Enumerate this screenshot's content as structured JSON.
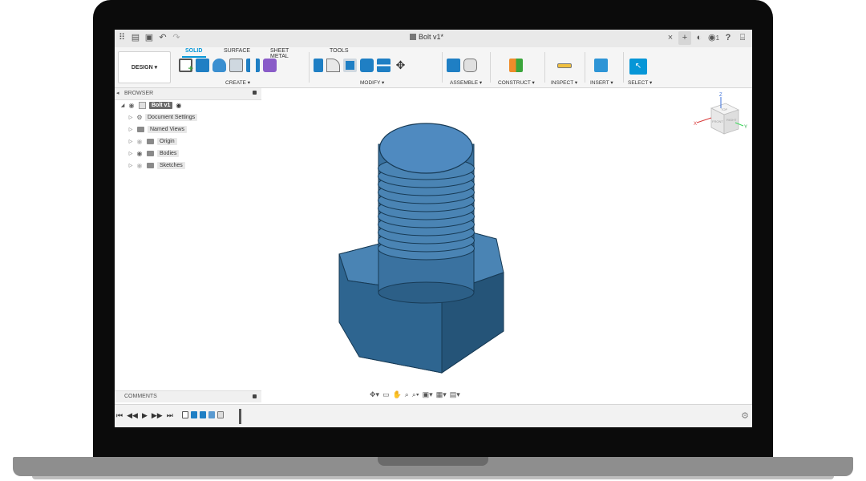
{
  "titlebar": {
    "doc_title": "Bolt v1*",
    "close_icon": "×",
    "plus_icon": "+",
    "notification_count": "1",
    "help_icon": "?",
    "icons": [
      "grid-icon",
      "file-icon",
      "save-icon",
      "undo-icon",
      "redo-icon"
    ]
  },
  "ribbon": {
    "tabs": [
      "SOLID",
      "SURFACE",
      "SHEET METAL",
      "TOOLS"
    ],
    "active_tab": "SOLID",
    "workspace": "DESIGN ▾",
    "groups": [
      "CREATE ▾",
      "MODIFY ▾",
      "ASSEMBLE ▾",
      "CONSTRUCT ▾",
      "INSPECT ▾",
      "INSERT ▾",
      "SELECT ▾"
    ]
  },
  "browser": {
    "title": "BROWSER",
    "root": "Bolt v1",
    "items": [
      "Document Settings",
      "Named Views",
      "Origin",
      "Bodies",
      "Sketches"
    ]
  },
  "comments": {
    "title": "COMMENTS"
  },
  "viewcube": {
    "top": "TOP",
    "front": "FRONT",
    "right": "RIGHT",
    "x": "X",
    "y": "Y",
    "z": "Z"
  },
  "colors": {
    "accent": "#0696d7",
    "body_top": "#4a84b4",
    "body_side": "#2c5f87"
  }
}
